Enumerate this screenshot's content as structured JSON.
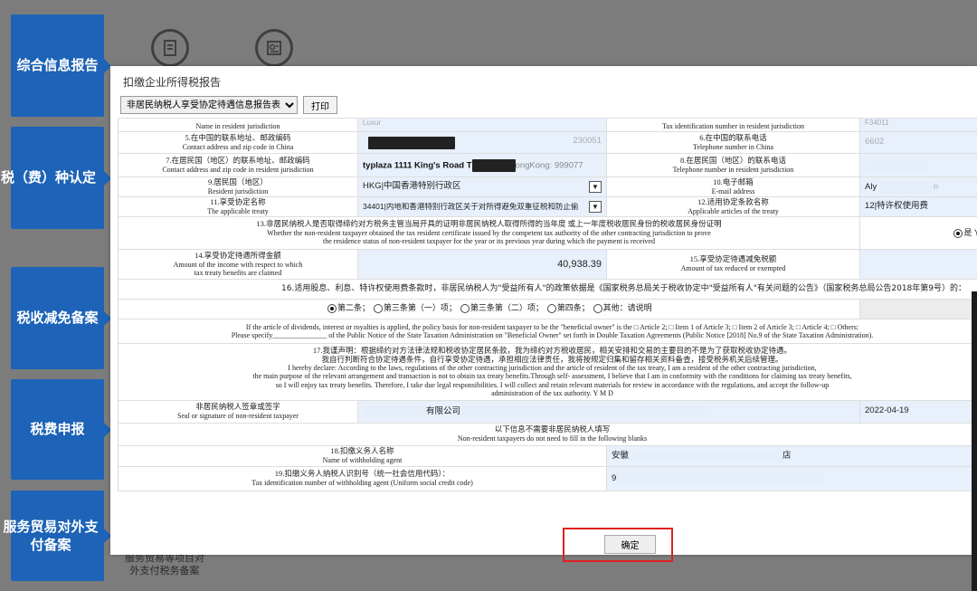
{
  "sidebar": {
    "items": [
      {
        "label": "综合信息报告"
      },
      {
        "label": "税（费）种认定"
      },
      {
        "label": "税收减免备案"
      },
      {
        "label": "税费申报"
      },
      {
        "label": "服务贸易对外支付备案"
      }
    ]
  },
  "background": {
    "bottom_link": "服务贸易等项目对外支付税务备案",
    "icons": [
      "document-icon",
      "report-icon"
    ]
  },
  "modal": {
    "title": "扣缴企业所得税报告",
    "report_select": "非居民纳税人享受协定待遇信息报告表",
    "print_button": "打印",
    "confirm_button": "确定"
  },
  "form": {
    "row_name": {
      "label_en": "Name in resident jurisdiction",
      "value_partial": "Luxur",
      "right_label_en": "Tax identification number in resident jurisdiction",
      "right_value_partial": "F34011"
    },
    "row5": {
      "label_cn": "5.在中国的联系地址、邮政编码",
      "label_en": "Contact address and zip code in China",
      "value_partial": "230051",
      "right_label_cn": "6.在中国的联系电话",
      "right_label_en": "Telephone number in China",
      "right_value_partial": "6602"
    },
    "row7": {
      "label_cn": "7.在居民国（地区）的联系地址、邮政编码",
      "label_en": "Contact address and zip code in resident jurisdiction",
      "value_prefix": "typlaza 1111 King's Road T",
      "value_suffix": "ongKong: 999077",
      "right_label_cn": "8.在居民国（地区）的联系电话",
      "right_label_en": "Telephone number in resident jurisdiction"
    },
    "row9": {
      "label_cn": "9.居民国（地区）",
      "label_en": "Resident jurisdiction",
      "value": "HKG|中国香港特别行政区",
      "right_label_cn": "10.电子邮箱",
      "right_label_en": "E-mail address",
      "right_value_partial": "Aly",
      "right_value_tail": "n"
    },
    "row11": {
      "label_cn": "11.享受协定名称",
      "label_en": "The applicable treaty",
      "value": "34401|内地和香港特别行政区关于对所得避免双重征税和防止偷",
      "right_label_cn": "12.适用协定条款名称",
      "right_label_en": "Applicable articles of the treaty",
      "right_value": "12|特许权使用费"
    },
    "row13": {
      "cn": "13.非居民纳税人是否取得缔约对方税务主管当局开具的证明非居民纳税人取得所得的当年度 或上一年度税收居民身份的税收居民身份证明",
      "en1": "Whether the non-resident taxpayer obtained the tax resident certificate issued by the competent tax authority of the other contracting jurisdiction to prove",
      "en2": "the residence status of non-resident taxpayer for the year or its previous year during which the payment is received",
      "answer": "是 Ye"
    },
    "row14": {
      "label_cn": "14.享受协定待遇所得金额",
      "label_en1": "Amount of the income with respect to which",
      "label_en2": "tax treaty benefits are claimed",
      "value": "40,938.39",
      "right_label_cn": "15.享受协定待遇减免税额",
      "right_label_en": "Amount of tax reduced or exempted"
    },
    "row16": {
      "cn": "16.适用股息、利息、特许权使用费条款时，非居民纳税人为\"受益所有人\"的政策依据是《国家税务总局关于税收协定中\"受益所有人\"有关问题的公告》（国家税务总局公告2018年第9号）的：",
      "options": [
        "第二条",
        "第三条第（一）项",
        "第三条第（二）项",
        "第四条",
        "其他：请说明"
      ],
      "en1": "If the article of dividends, interest or royalties is applied, the policy basis for non-resident taxpayer to be the \"beneficial owner\" is the □ Article 2; □ Item 1 of Article 3; □ Item 2 of Article 3; □ Article 4; □ Others:",
      "en2": "Please specify_______________ of the Public Notice of the State Taxation Administration on \"Beneficial Owner\" set forth in Double Taxation Agreements (Public Notice [2018] No.9 of the State Taxation Administration)."
    },
    "row17": {
      "cn1": "17.我谨声明：根据缔约对方法律法规和税收协定居民条款，我为缔约对方税收居民，相关安排和交易的主要目的不是为了获取税收协定待遇。",
      "cn2": "我自行判断符合协定待遇条件，自行享受协定待遇，承担相应法律责任，我将按规定归集和留存相关资料备查，接受税务机关后续管理。",
      "en1": "I hereby declare: According to the laws, regulations of the other contracting jurisdiction and the article of resident of the tax treaty, I am a resident of the other contracting jurisdiction,",
      "en2": "the main purpose of the relevant arrangement and transaction is not to obtain tax treaty benefits.Through self- assessment, I believe that I am in conformity with the conditions for claiming tax treaty benefits,",
      "en3": "so I will enjoy tax treaty benefits. Therefore, I take due legal responsibilities. I will collect and retain relevant materials for review in accordance with the regulations, and accept the follow-up",
      "en4": "administration of the tax authority. Y M D"
    },
    "row_seal": {
      "label_cn": "非居民纳税人签章或签字",
      "label_en": "Seal or signature of non-resident taxpayer",
      "value_partial": "有限公司",
      "date": "2022-04-19"
    },
    "row_note": {
      "cn": "以下信息不需要非居民纳税人填写",
      "en": "Non-resident taxpayers do not need to fill in the following blanks"
    },
    "row18": {
      "label_cn": "18.扣缴义务人名称",
      "label_en": "Name of withholding agent",
      "value_partial": "安徽",
      "value_tail": "店"
    },
    "row19": {
      "label_cn": "19.扣缴义务人纳税人识别号（统一社会信用代码）：",
      "label_en": "Tax identification number of withholding agent (Uniform social credit code)",
      "value_partial": "9"
    }
  },
  "colors": {
    "sidebar": "#1d63b7",
    "overlay": "#7c7c7c",
    "field": "#e8f0fc",
    "highlight": "#e02020"
  }
}
